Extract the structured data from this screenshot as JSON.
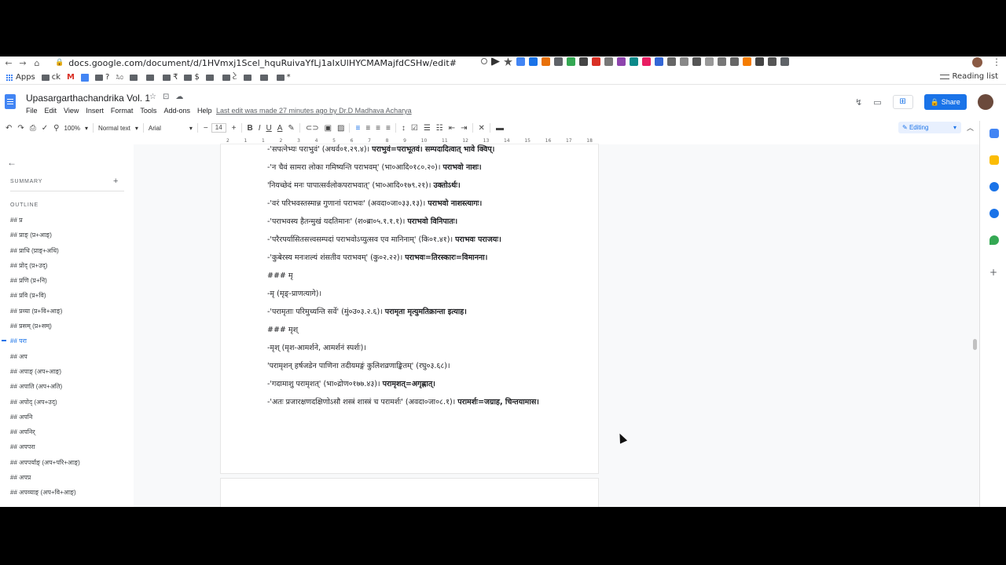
{
  "browser": {
    "url": "docs.google.com/document/d/1HVmxj1Scel_hquRuivaYfLj1aIxUlHYCMAMajfdCSHw/edit#",
    "back": "←",
    "forward": "→",
    "home": "⌂",
    "reading_list": "Reading list",
    "bookmarks": [
      {
        "label": "Apps"
      },
      {
        "label": "ck"
      },
      {
        "label": "M"
      },
      {
        "label": "?"
      },
      {
        "label": "ಸಿಂ"
      },
      {
        "label": "₹"
      },
      {
        "label": "$"
      },
      {
        "label": "ટે"
      },
      {
        "label": "*"
      }
    ]
  },
  "docs": {
    "title": "Upasargarthachandrika Vol. 1",
    "menu": [
      "File",
      "Edit",
      "View",
      "Insert",
      "Format",
      "Tools",
      "Add-ons",
      "Help"
    ],
    "last_edit": "Last edit was made 27 minutes ago by Dr.D Madhava Acharya",
    "share_label": "Share",
    "mode_label": "Editing"
  },
  "toolbar": {
    "zoom": "100%",
    "style": "Normal text",
    "font": "Arial",
    "font_size": "14"
  },
  "ruler": [
    "2",
    "1",
    "1",
    "2",
    "3",
    "4",
    "5",
    "6",
    "7",
    "8",
    "9",
    "10",
    "11",
    "12",
    "13",
    "14",
    "15",
    "16",
    "17",
    "18"
  ],
  "sidebar": {
    "summary_label": "SUMMARY",
    "outline_label": "OUTLINE",
    "outline_items": [
      {
        "label": "## प्र",
        "active": false
      },
      {
        "label": "## प्राङ् (प्र+आङ्)",
        "active": false
      },
      {
        "label": "## प्राधि (प्राङ्+अधि)",
        "active": false
      },
      {
        "label": "## प्रोद् (प्र+उद्)",
        "active": false
      },
      {
        "label": "## प्रणि (प्र+नि)",
        "active": false
      },
      {
        "label": "## प्रवि (प्र+वि)",
        "active": false
      },
      {
        "label": "## प्रव्या (प्र+वि+आङ्)",
        "active": false
      },
      {
        "label": "## प्रसम् (प्र+सम्)",
        "active": false
      },
      {
        "label": "## परा",
        "active": true
      },
      {
        "label": "## अप",
        "active": false
      },
      {
        "label": "## अपाङ् (अप+आङ्)",
        "active": false
      },
      {
        "label": "## अपाति (अप+अति)",
        "active": false
      },
      {
        "label": "## अपोद् (अप+उद्)",
        "active": false
      },
      {
        "label": "## अपनि",
        "active": false
      },
      {
        "label": "## अपनिर्",
        "active": false
      },
      {
        "label": "## अपपरा",
        "active": false
      },
      {
        "label": "## अपपर्याङ् (अप+परि+आङ्)",
        "active": false
      },
      {
        "label": "## अपप्र",
        "active": false
      },
      {
        "label": "## अपव्याङ् (अप+वि+आङ्)",
        "active": false
      }
    ]
  },
  "document": {
    "paragraphs": [
      {
        "plain": "-'सपत्नेभ्यः पराभुवं' (अथर्व०१.२९.४)। ",
        "bold": "पराभुवं=पराभूतवं। सम्पदादित्वात् भावे क्विप्।"
      },
      {
        "plain": "-'न चैवं सामरा लोका गमिष्यन्ति पराभवम्' (भा०आदि०१८०.२०)। ",
        "bold": "पराभवो नाशः।"
      },
      {
        "plain": "'नियच्छेदं मनः पापात्सर्वलोकपराभवात्' (भा०आदि०१७९.२१)। ",
        "bold": "उक्तोऽर्थः।"
      },
      {
        "plain": "-'वरं परिभवस्तस्मान्न गुणानां पराभवः' (अवदा०जा०३३.१३)। ",
        "bold": "पराभवो नाशस्त्यागः।"
      },
      {
        "plain": "-'पराभवस्य हैतन्मुखं यदतिमानः' (श०ब्रा०५.१.१.१)। ",
        "bold": "पराभवो विनिपातः।"
      },
      {
        "plain": "-'परैरपर्यासितसत्त्वसम्पदां पराभवोऽप्युत्सव एव मानिनाम्' (कि०१.४१)। ",
        "bold": "पराभवः पराजयः।"
      },
      {
        "plain": "-'कुबेरस्य मनःशल्यं शंसतीव पराभवम्' (कु०२.२२)। ",
        "bold": "पराभवः=तिरस्कारः=विमानना।"
      },
      {
        "plain": "### मृ",
        "bold": ""
      },
      {
        "plain": "-मृ (मृङ्-प्राणत्यागे)।",
        "bold": ""
      },
      {
        "plain": "-'परामृताः परिमुच्यन्ति सर्वे' (मुं०उ०३.२.६)। ",
        "bold": "परामृता मृत्युमतिक्रान्ता इत्याह।"
      },
      {
        "plain": "### मृश्",
        "bold": ""
      },
      {
        "plain": "-मृश् (मृश-आमर्शने, आमर्शनं स्पर्शः)।",
        "bold": ""
      },
      {
        "plain": "'परामृशन् हर्षजडेन पाणिना तदीयमङ्गं कुलिशव्रणाङ्कितम्' (रघु०३.६८)।",
        "bold": ""
      },
      {
        "plain": "-'गदामाशु परामृशत्' (भा०द्रोण०१७७.४३)। ",
        "bold": "परामृशत्=अगृह्णात्।"
      },
      {
        "plain": "-'अतः प्रजारक्षणदक्षिणोऽसौ शस्त्रं शास्त्रं च परामर्शः' (अवदा०जा०८.१)। ",
        "bold": "परामर्शः=जग्राह, चिन्तयामास।"
      }
    ]
  },
  "colors": {
    "accent": "#1a73e8",
    "docs_blue": "#4285f4"
  }
}
